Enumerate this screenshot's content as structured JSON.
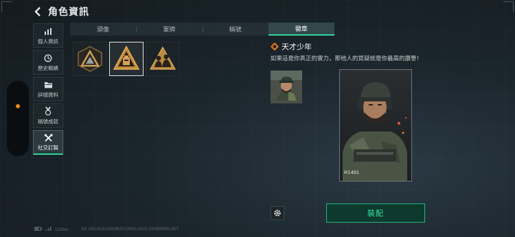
{
  "header": {
    "title": "角色資訊"
  },
  "nav": {
    "items": [
      {
        "label": "個人資訊",
        "icon": "bar-chart-icon"
      },
      {
        "label": "歷史戰績",
        "icon": "clock-icon"
      },
      {
        "label": "詳細資料",
        "icon": "folder-icon"
      },
      {
        "label": "稱號成就",
        "icon": "medal-icon"
      },
      {
        "label": "社交訂製",
        "icon": "tools-icon",
        "active": true
      }
    ]
  },
  "tabs": [
    {
      "label": "頭像"
    },
    {
      "label": "軍牌"
    },
    {
      "label": "稱號"
    },
    {
      "label": "徽章",
      "active": true
    }
  ],
  "badges": [
    {
      "icon": "triangle-badge-icon"
    },
    {
      "icon": "supply-badge-icon",
      "selected": true
    },
    {
      "icon": "squad-badge-icon"
    }
  ],
  "detail": {
    "title": "天才少年",
    "description": "如果這是你真正的實力，那他人的質疑就是你最高的讚譽！",
    "portrait_id": "R1491"
  },
  "buttons": {
    "equip": "裝配"
  },
  "status": {
    "ping": "120ms",
    "uid": "SA UID:8151350982072653 4221,202609051407"
  },
  "colors": {
    "accent": "#2fd69a",
    "orange": "#f08a1a",
    "badge_gold": "#c9a25a"
  }
}
